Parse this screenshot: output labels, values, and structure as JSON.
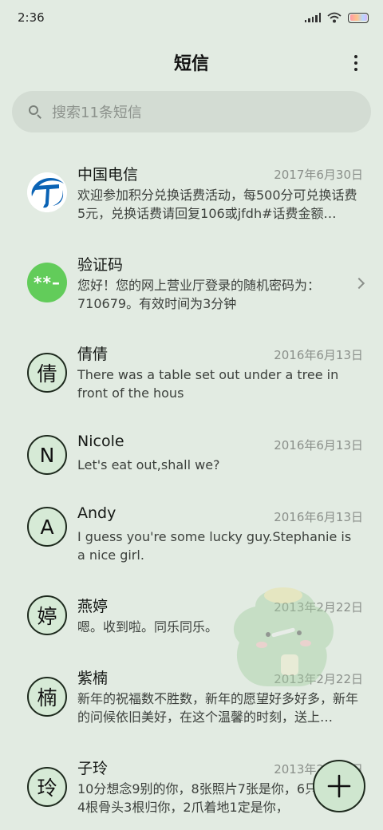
{
  "status_bar": {
    "time": "2:36",
    "icons": [
      "signal-icon",
      "wifi-icon",
      "battery-icon"
    ]
  },
  "header": {
    "title": "短信",
    "more_icon": "more-vertical-icon"
  },
  "search": {
    "placeholder": "搜索11条短信",
    "icon": "search-icon"
  },
  "conversations": [
    {
      "name": "中国电信",
      "date": "2017年6月30日",
      "preview": "欢迎参加积分兑换话费活动，每500分可兑换话费5元，兑换话费请回复106或jfdh#话费金额…",
      "avatar": "china-telecom-logo"
    },
    {
      "name": "验证码",
      "date": "",
      "preview": "您好！您的网上营业厅登录的随机密码为：710679。有效时间为3分钟",
      "avatar_text": "**–"
    },
    {
      "name": "倩倩",
      "date": "2016年6月13日",
      "preview": "There was a table set out under a tree in front of the hous",
      "avatar_text": "倩"
    },
    {
      "name": "Nicole",
      "date": "2016年6月13日",
      "preview": "Let's eat out,shall we?",
      "avatar_text": "N"
    },
    {
      "name": "Andy",
      "date": "2016年6月13日",
      "preview": "I guess you're some lucky guy.Stephanie is a nice girl.",
      "avatar_text": "A"
    },
    {
      "name": "燕婷",
      "date": "2013年2月22日",
      "preview": "嗯。收到啦。同乐同乐。",
      "avatar_text": "婷"
    },
    {
      "name": "紫楠",
      "date": "2013年2月22日",
      "preview": "新年的祝福数不胜数，新年的愿望好多好多，新年的问候依旧美好，在这个温馨的时刻，送上…",
      "avatar_text": "楠"
    },
    {
      "name": "子玲",
      "date": "2013年2月22日",
      "preview": "10分想念9别的你，8张照片7张是你，6只像你，4根骨头3根归你，2爪着地1定是你，",
      "avatar_text": "玲"
    }
  ],
  "fab": {
    "icon": "plus-icon"
  },
  "colors": {
    "background": "#e2ebe2",
    "search_bg": "#d3dcd3",
    "avatar_bg": "#d6ead6",
    "verify_green": "#62cc5a",
    "telecom_blue": "#0a63b5"
  }
}
